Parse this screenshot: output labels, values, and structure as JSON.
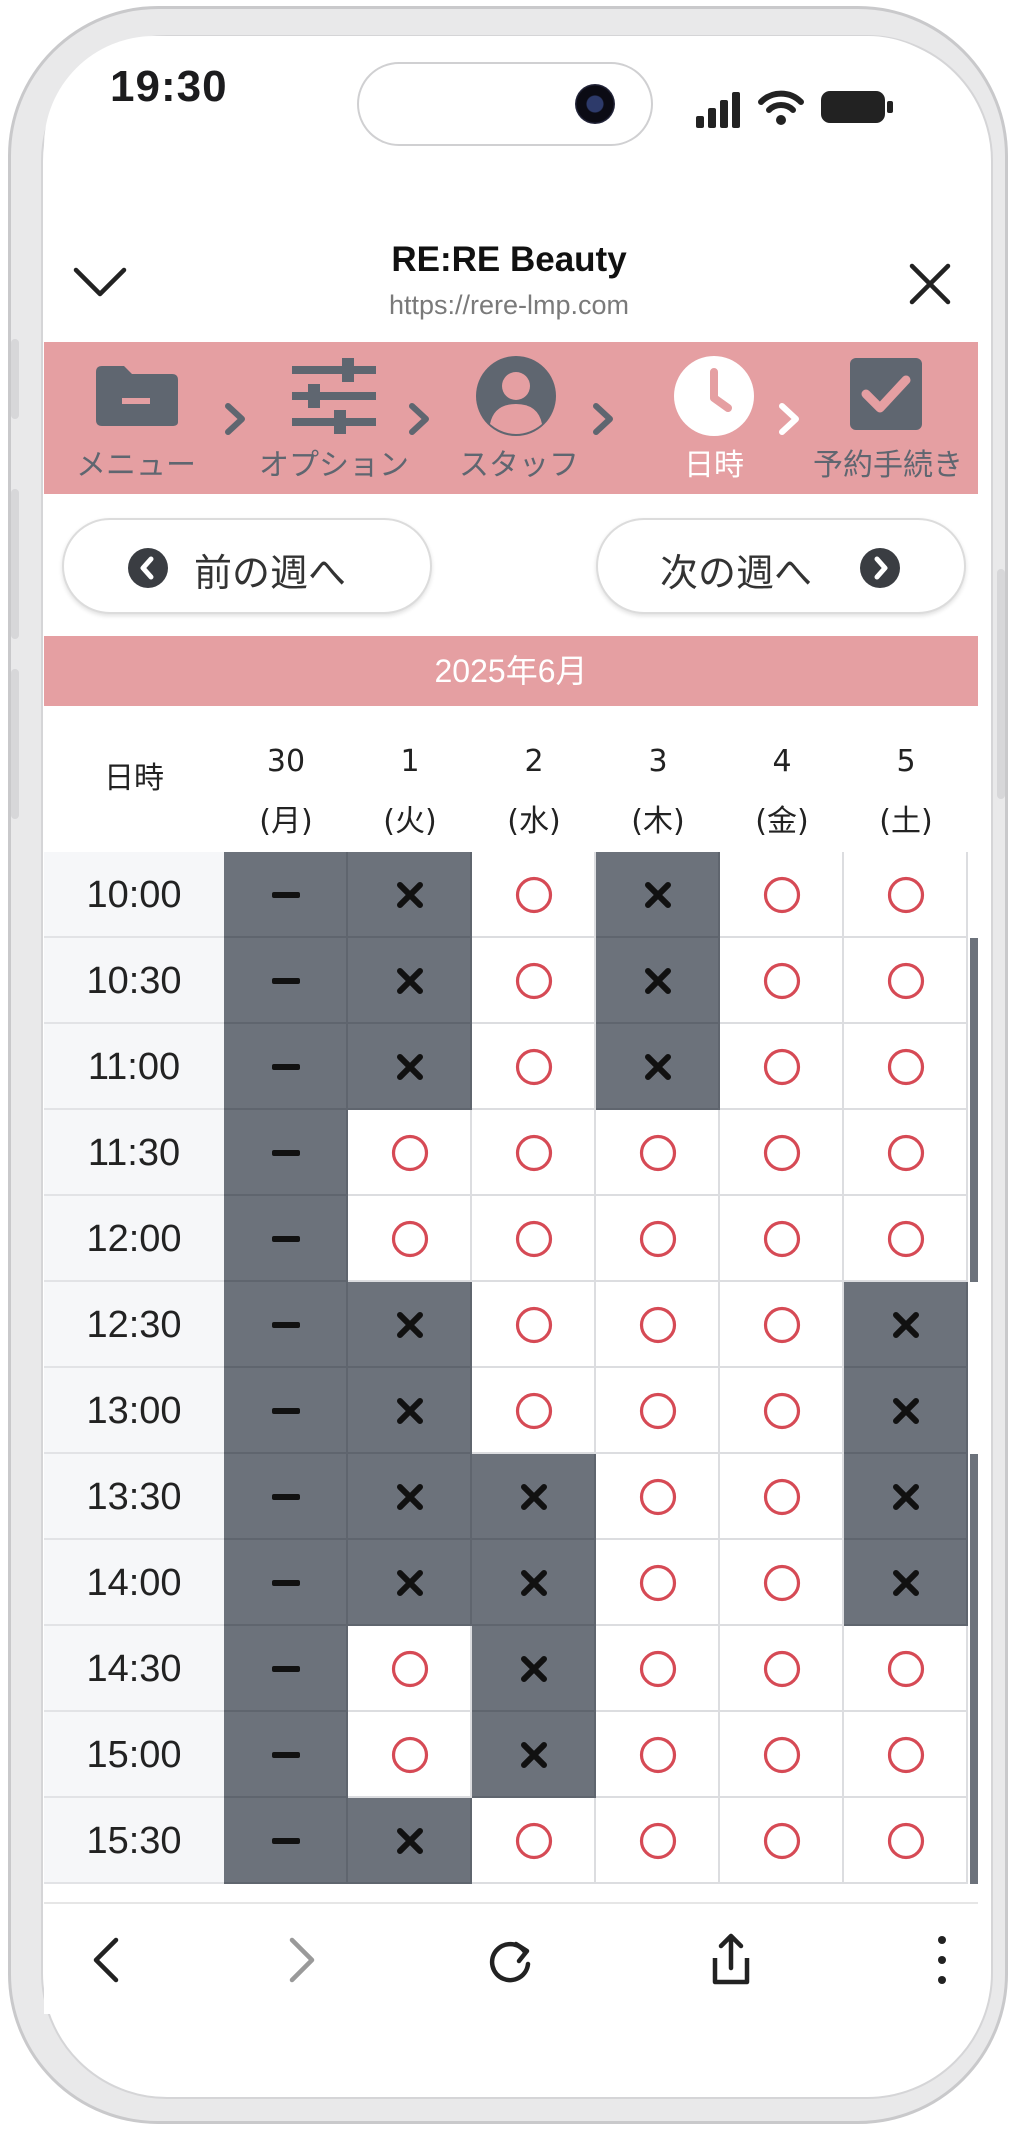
{
  "status": {
    "time": "19:30"
  },
  "browser": {
    "title": "RE:RE Beauty",
    "url": "https://rere-lmp.com"
  },
  "steps": [
    {
      "label": "メニュー",
      "icon": "folder-icon",
      "active": false
    },
    {
      "label": "オプション",
      "icon": "sliders-icon",
      "active": false
    },
    {
      "label": "スタッフ",
      "icon": "user-icon",
      "active": false
    },
    {
      "label": "日時",
      "icon": "clock-icon",
      "active": true
    },
    {
      "label": "予約手続き",
      "icon": "checkbox-icon",
      "active": false
    }
  ],
  "week_nav": {
    "prev": "前の週へ",
    "next": "次の週へ"
  },
  "month": "2025年6月",
  "table": {
    "corner": "日時",
    "days": [
      {
        "date": "30",
        "weekday": "(月)"
      },
      {
        "date": "1",
        "weekday": "(火)"
      },
      {
        "date": "2",
        "weekday": "(水)"
      },
      {
        "date": "3",
        "weekday": "(木)"
      },
      {
        "date": "4",
        "weekday": "(金)"
      },
      {
        "date": "5",
        "weekday": "(土)"
      }
    ],
    "rows": [
      {
        "time": "10:00",
        "slots": [
          "-",
          "x",
          "o",
          "x",
          "o",
          "o"
        ]
      },
      {
        "time": "10:30",
        "slots": [
          "-",
          "x",
          "o",
          "x",
          "o",
          "o"
        ]
      },
      {
        "time": "11:00",
        "slots": [
          "-",
          "x",
          "o",
          "x",
          "o",
          "o"
        ]
      },
      {
        "time": "11:30",
        "slots": [
          "-",
          "o",
          "o",
          "o",
          "o",
          "o"
        ]
      },
      {
        "time": "12:00",
        "slots": [
          "-",
          "o",
          "o",
          "o",
          "o",
          "o"
        ]
      },
      {
        "time": "12:30",
        "slots": [
          "-",
          "x",
          "o",
          "o",
          "o",
          "x"
        ]
      },
      {
        "time": "13:00",
        "slots": [
          "-",
          "x",
          "o",
          "o",
          "o",
          "x"
        ]
      },
      {
        "time": "13:30",
        "slots": [
          "-",
          "x",
          "x",
          "o",
          "o",
          "x"
        ]
      },
      {
        "time": "14:00",
        "slots": [
          "-",
          "x",
          "x",
          "o",
          "o",
          "x"
        ]
      },
      {
        "time": "14:30",
        "slots": [
          "-",
          "o",
          "x",
          "o",
          "o",
          "o"
        ]
      },
      {
        "time": "15:00",
        "slots": [
          "-",
          "o",
          "x",
          "o",
          "o",
          "o"
        ]
      },
      {
        "time": "15:30",
        "slots": [
          "-",
          "x",
          "o",
          "o",
          "o",
          "o"
        ]
      }
    ]
  },
  "colors": {
    "accent_pink": "#e59fa2",
    "booked_gray": "#6c727b",
    "available_red": "#d64a55"
  }
}
